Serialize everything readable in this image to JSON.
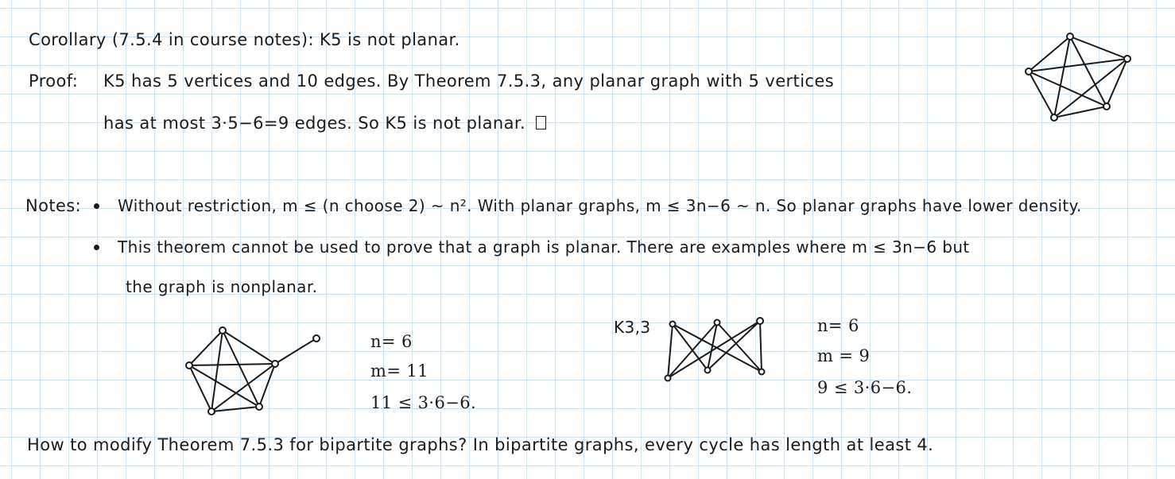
{
  "corollary": {
    "label": "Corollary",
    "ref": "(7.5.4 in course notes):",
    "statement": "K5 is not planar."
  },
  "proof": {
    "label": "Proof:",
    "line1": "K5 has 5 vertices and 10 edges.  By Theorem 7.5.3, any planar graph with 5 vertices",
    "line2": "has at most 3·5−6=9 edges.  So K5 is not planar."
  },
  "notes": {
    "label": "Notes:",
    "bullet1": "Without restriction, m ≤ (n choose 2) ~ n².  With planar graphs, m ≤ 3n−6 ~ n.  So planar graphs have lower density.",
    "bullet2_line1": "This theorem cannot be used to prove that a graph is planar.  There are examples where m ≤ 3n−6 but",
    "bullet2_line2": "the graph is nonplanar."
  },
  "example1": {
    "n": "n= 6",
    "m": "m= 11",
    "ineq": "11 ≤ 3·6−6."
  },
  "example2": {
    "label": "K3,3",
    "n": "n= 6",
    "m": "m = 9",
    "ineq": "9 ≤ 3·6−6."
  },
  "question": "How to modify Theorem 7.5.3 for bipartite graphs?  In bipartite graphs, every cycle has length at least 4."
}
